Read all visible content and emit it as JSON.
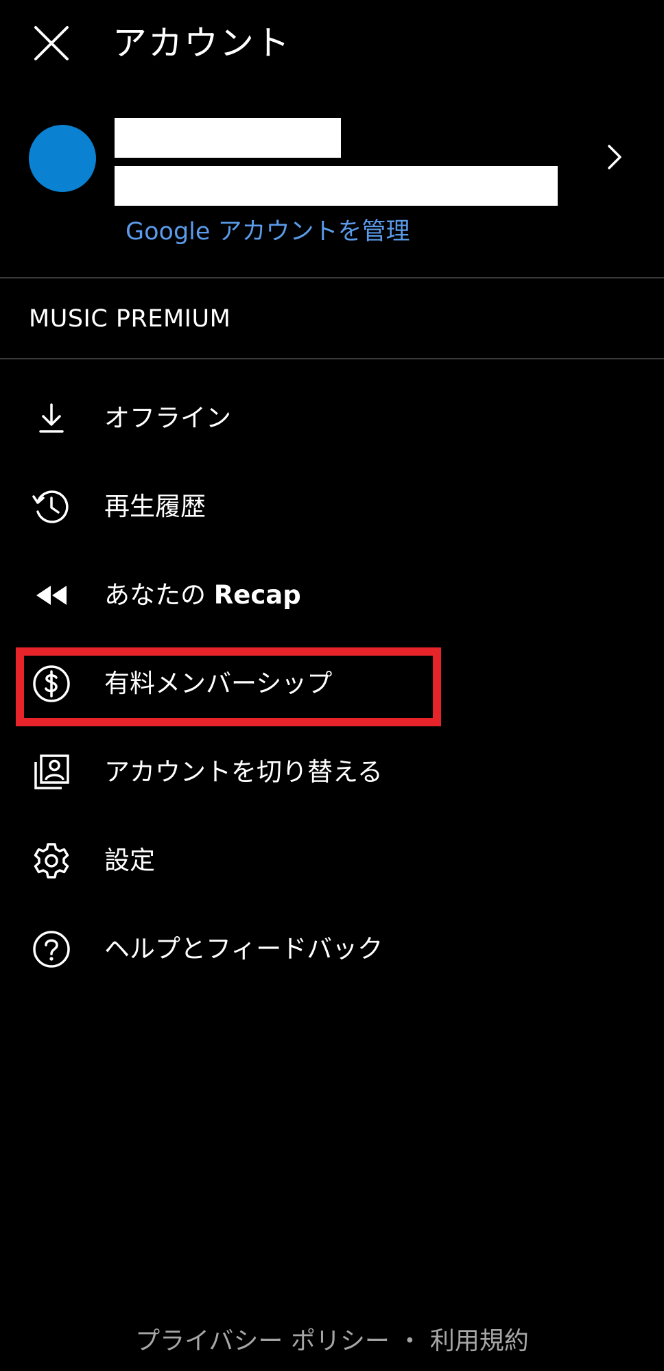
{
  "header": {
    "title": "アカウント",
    "close_icon": "close-icon"
  },
  "account": {
    "avatar_color": "#0b81d1",
    "manage_link": "Google アカウントを管理",
    "chevron_icon": "chevron-right-icon"
  },
  "section": {
    "label": "MUSIC PREMIUM"
  },
  "menu": {
    "items": [
      {
        "icon": "download-icon",
        "label": "オフライン"
      },
      {
        "icon": "history-icon",
        "label": "再生履歴"
      },
      {
        "icon": "rewind-icon",
        "label_prefix": "あなたの ",
        "label_bold": "Recap"
      },
      {
        "icon": "paid-membership-icon",
        "label": "有料メンバーシップ",
        "highlighted": true
      },
      {
        "icon": "switch-account-icon",
        "label": "アカウントを切り替える"
      },
      {
        "icon": "gear-icon",
        "label": "設定"
      },
      {
        "icon": "help-icon",
        "label": "ヘルプとフィードバック"
      }
    ]
  },
  "annotation": {
    "highlight_color": "#e8242b"
  },
  "footer": {
    "privacy": "プライバシー ポリシー",
    "separator": "・",
    "terms": "利用規約"
  }
}
